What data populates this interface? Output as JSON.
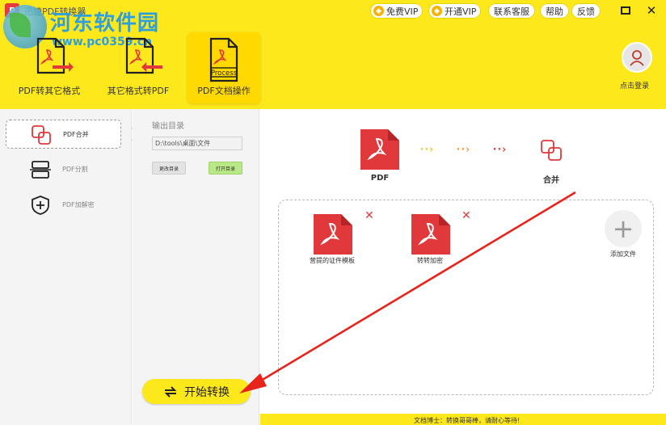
{
  "window": {
    "app_title": "迅捷PDF转换器",
    "close_glyph": "✕"
  },
  "watermark": {
    "text": "河东软件园",
    "url": "www.pc0359.cn"
  },
  "header": {
    "free_vip": "免费VIP",
    "open_vip": "开通VIP",
    "contact": "联系客服",
    "help": "帮助",
    "feedback": "反馈",
    "pdf_badge": "P"
  },
  "tabs": [
    {
      "label": "PDF转其它格式"
    },
    {
      "label": "其它格式转PDF"
    },
    {
      "label": "PDF文档操作",
      "active": true,
      "icon_text": "Process"
    }
  ],
  "login": {
    "label": "点击登录"
  },
  "sidebar": {
    "items": [
      {
        "label": "PDF合并",
        "active": true
      },
      {
        "label": "PDF分割"
      },
      {
        "label": "PDF加解密"
      }
    ]
  },
  "output": {
    "label": "输出目录",
    "path": "D:\\tools\\桌面\\文件",
    "change_btn": "更改目录",
    "open_btn": "打开目录"
  },
  "flow": {
    "from_label": "PDF",
    "to_label": "合并",
    "arrow_glyph": "··›"
  },
  "files": [
    {
      "name": "营提的证件模板"
    },
    {
      "name": "转转加密"
    }
  ],
  "add_file": {
    "label": "添加文件",
    "glyph": "+"
  },
  "start_button": {
    "label": "开始转换"
  },
  "footer": {
    "tip": "文档博士：转换哥哥棒，请耐心等待!"
  },
  "colors": {
    "accent_yellow": "#fde81c",
    "pdf_red": "#e0383b",
    "annotation_red": "#e8231c"
  }
}
